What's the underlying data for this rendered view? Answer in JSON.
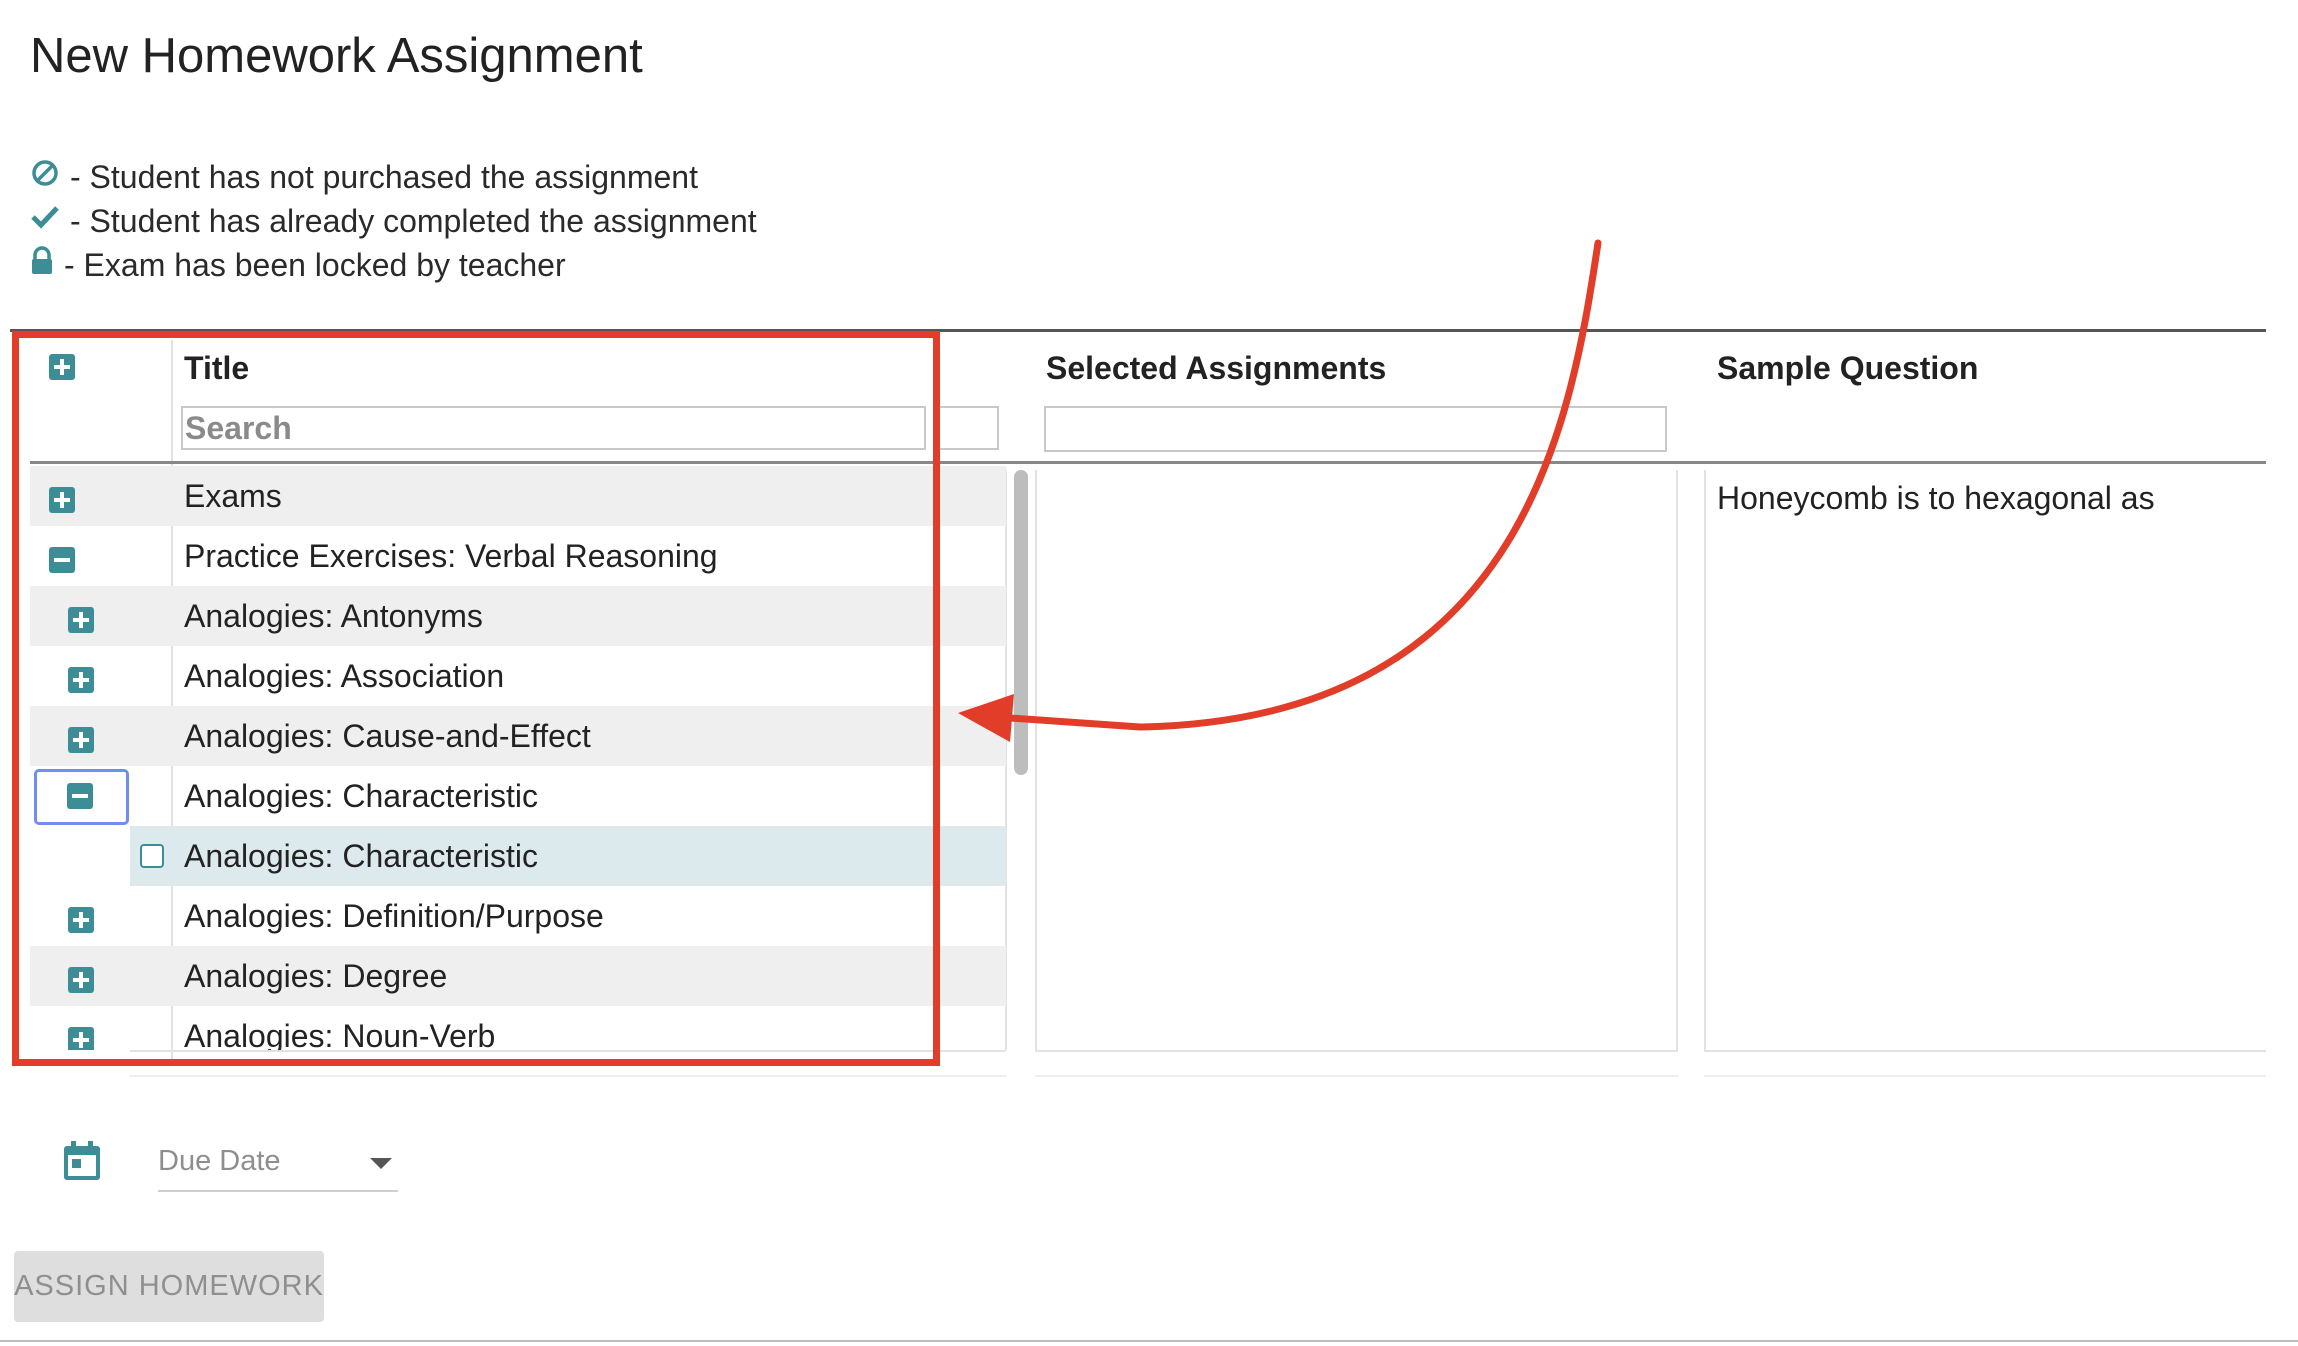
{
  "page": {
    "title": "New Homework Assignment"
  },
  "legend": [
    {
      "icon": "ban-icon",
      "text": "- Student has not purchased the assignment"
    },
    {
      "icon": "check-icon",
      "text": "- Student has already completed the assignment"
    },
    {
      "icon": "lock-icon",
      "text": "- Exam has been locked by teacher"
    }
  ],
  "grid": {
    "columns": {
      "title": "Title",
      "selected": "Selected Assignments",
      "sample": "Sample Question"
    },
    "search_placeholder": "Search",
    "rows": [
      {
        "label": "Exams",
        "toggle": "expand"
      },
      {
        "label": "Practice Exercises: Verbal Reasoning",
        "toggle": "collapse"
      },
      {
        "label": "Analogies: Antonyms",
        "toggle": "expand"
      },
      {
        "label": "Analogies: Association",
        "toggle": "expand"
      },
      {
        "label": "Analogies: Cause-and-Effect",
        "toggle": "expand"
      },
      {
        "label": "Analogies: Characteristic",
        "toggle": "collapse",
        "focused": true
      },
      {
        "label": "Analogies: Characteristic",
        "toggle": "checkbox",
        "selected": true,
        "checked": false
      },
      {
        "label": "Analogies: Definition/Purpose",
        "toggle": "expand"
      },
      {
        "label": "Analogies: Degree",
        "toggle": "expand"
      },
      {
        "label": "Analogies: Noun-Verb",
        "toggle": "expand"
      }
    ],
    "sample_question_text": "Honeycomb is to hexagonal as"
  },
  "due_date": {
    "placeholder": "Due Date",
    "icon": "calendar-icon"
  },
  "assign_button": {
    "label": "ASSIGN HOMEWORK"
  },
  "colors": {
    "accent": "#3d8d96",
    "annotation": "#e23d28",
    "focus": "#6f8ff0"
  }
}
